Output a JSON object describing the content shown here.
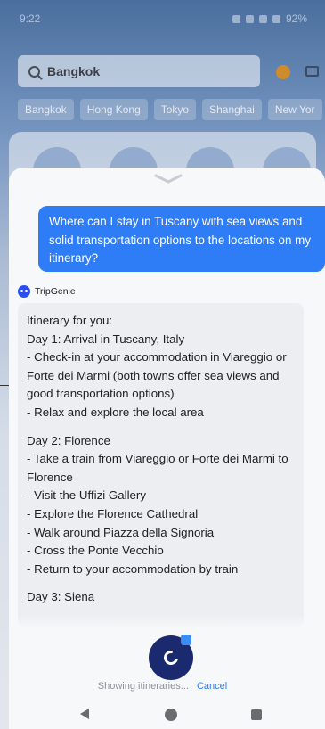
{
  "status_bar": {
    "time": "9:22",
    "battery": "92%"
  },
  "search": {
    "value": "Bangkok"
  },
  "city_tabs": [
    "Bangkok",
    "Hong Kong",
    "Tokyo",
    "Shanghai",
    "New Yor"
  ],
  "colors": {
    "accent": "#2e7cf6",
    "assistant_bg": "#eceef2",
    "loader": "#1b2a6e"
  },
  "icons": [
    "search-icon",
    "coin-icon",
    "mail-icon",
    "chevron-down-icon",
    "tripgenie-logo-icon",
    "ai-badge-icon"
  ],
  "chat": {
    "user_message": "Where can I stay in Tuscany with sea views and solid transportation options to the locations on my itinerary?",
    "assistant_name": "TripGenie",
    "reply": {
      "intro": "Itinerary for you:",
      "days": [
        {
          "title": "Day 1: Arrival in Tuscany, Italy",
          "items": [
            "- Check-in at your accommodation in Viareggio or Forte dei Marmi (both towns offer sea views and good transportation options)",
            "- Relax and explore the local area"
          ]
        },
        {
          "title": "Day 2: Florence",
          "items": [
            "- Take a train from Viareggio or Forte dei Marmi to Florence",
            "- Visit the Uffizi Gallery",
            "- Explore the Florence Cathedral",
            "- Walk around Piazza della Signoria",
            "- Cross the Ponte Vecchio",
            "- Return to your accommodation by train"
          ]
        },
        {
          "title": "Day 3: Siena",
          "items": []
        }
      ]
    }
  },
  "footer": {
    "status": "Showing itineraries...",
    "cancel": "Cancel"
  }
}
